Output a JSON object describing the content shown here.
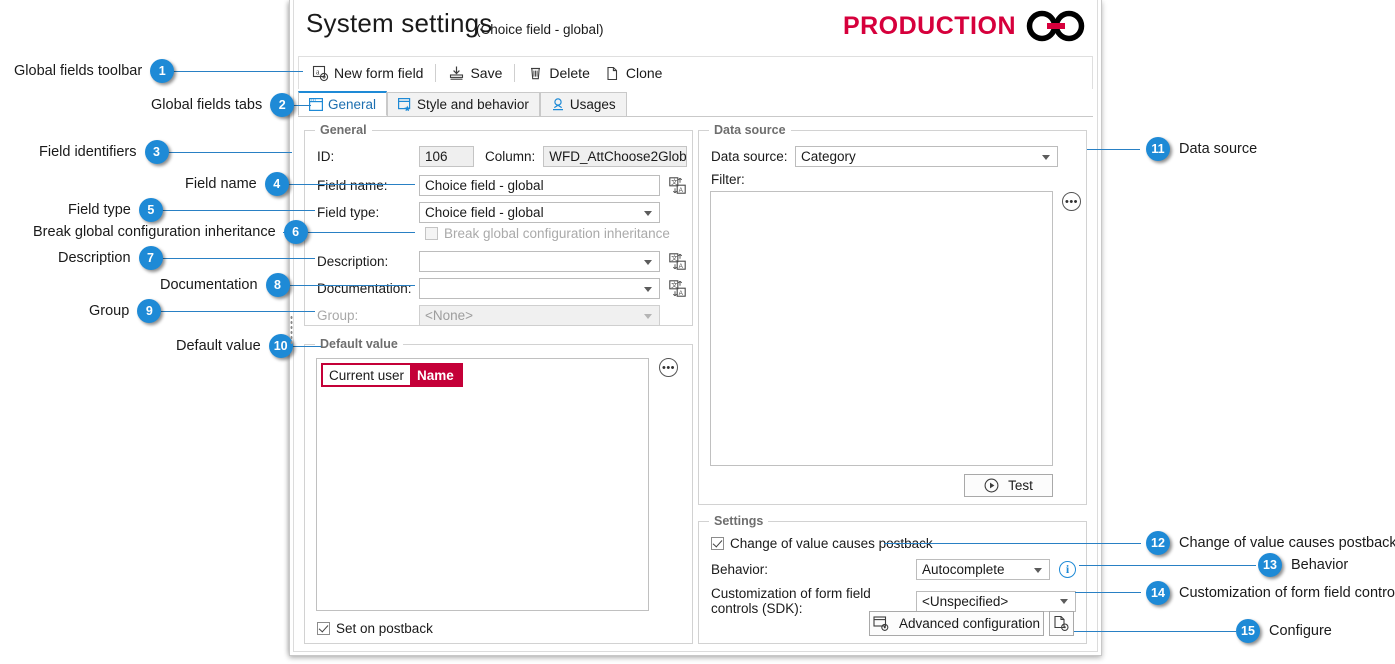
{
  "window": {
    "title": "System settings",
    "title_suffix": "(Choice field - global)",
    "logo_text": "PRODUCTION"
  },
  "toolbar": {
    "new_form_field": "New form field",
    "save": "Save",
    "delete": "Delete",
    "clone": "Clone"
  },
  "tabs": [
    {
      "label": "General",
      "active": true
    },
    {
      "label": "Style and behavior",
      "active": false
    },
    {
      "label": "Usages",
      "active": false
    }
  ],
  "general": {
    "group_title": "General",
    "id_label": "ID:",
    "id_value": "106",
    "column_label": "Column:",
    "column_value": "WFD_AttChoose2Glob",
    "field_name_label": "Field name:",
    "field_name_value": "Choice field - global",
    "field_type_label": "Field type:",
    "field_type_value": "Choice field - global",
    "break_inheritance_label": "Break global configuration inheritance",
    "break_inheritance_checked": false,
    "description_label": "Description:",
    "description_value": "",
    "documentation_label": "Documentation:",
    "documentation_value": "",
    "group_label": "Group:",
    "group_value": "<None>"
  },
  "default_value": {
    "group_title": "Default value",
    "tag_prefix": "Current user",
    "tag_token": "Name",
    "set_on_postback_label": "Set on postback",
    "set_on_postback_checked": true,
    "ellipsis": "•••"
  },
  "data_source": {
    "group_title": "Data source",
    "data_source_label": "Data source:",
    "data_source_value": "Category",
    "filter_label": "Filter:",
    "filter_value": "",
    "test_button": "Test",
    "ellipsis": "•••"
  },
  "settings": {
    "group_title": "Settings",
    "postback_label": "Change of value causes postback",
    "postback_checked": true,
    "behavior_label": "Behavior:",
    "behavior_value": "Autocomplete",
    "sdk_label": "Customization of form field controls (SDK):",
    "sdk_value": "<Unspecified>",
    "advanced_config": "Advanced configuration",
    "info_glyph": "i"
  },
  "callouts": [
    {
      "n": "1",
      "text": "Global fields toolbar"
    },
    {
      "n": "2",
      "text": "Global fields tabs"
    },
    {
      "n": "3",
      "text": "Field identifiers"
    },
    {
      "n": "4",
      "text": "Field name"
    },
    {
      "n": "5",
      "text": "Field type"
    },
    {
      "n": "6",
      "text": "Break global configuration inheritance"
    },
    {
      "n": "7",
      "text": "Description"
    },
    {
      "n": "8",
      "text": "Documentation"
    },
    {
      "n": "9",
      "text": "Group"
    },
    {
      "n": "10",
      "text": "Default value"
    },
    {
      "n": "11",
      "text": "Data source"
    },
    {
      "n": "12",
      "text": "Change of value causes postback"
    },
    {
      "n": "13",
      "text": "Behavior"
    },
    {
      "n": "14",
      "text": "Customization of form field controls"
    },
    {
      "n": "15",
      "text": "Configure"
    }
  ],
  "colors": {
    "accent": "#1e8ad6",
    "brand_red": "#d6003c",
    "tag_red": "#c40038"
  }
}
